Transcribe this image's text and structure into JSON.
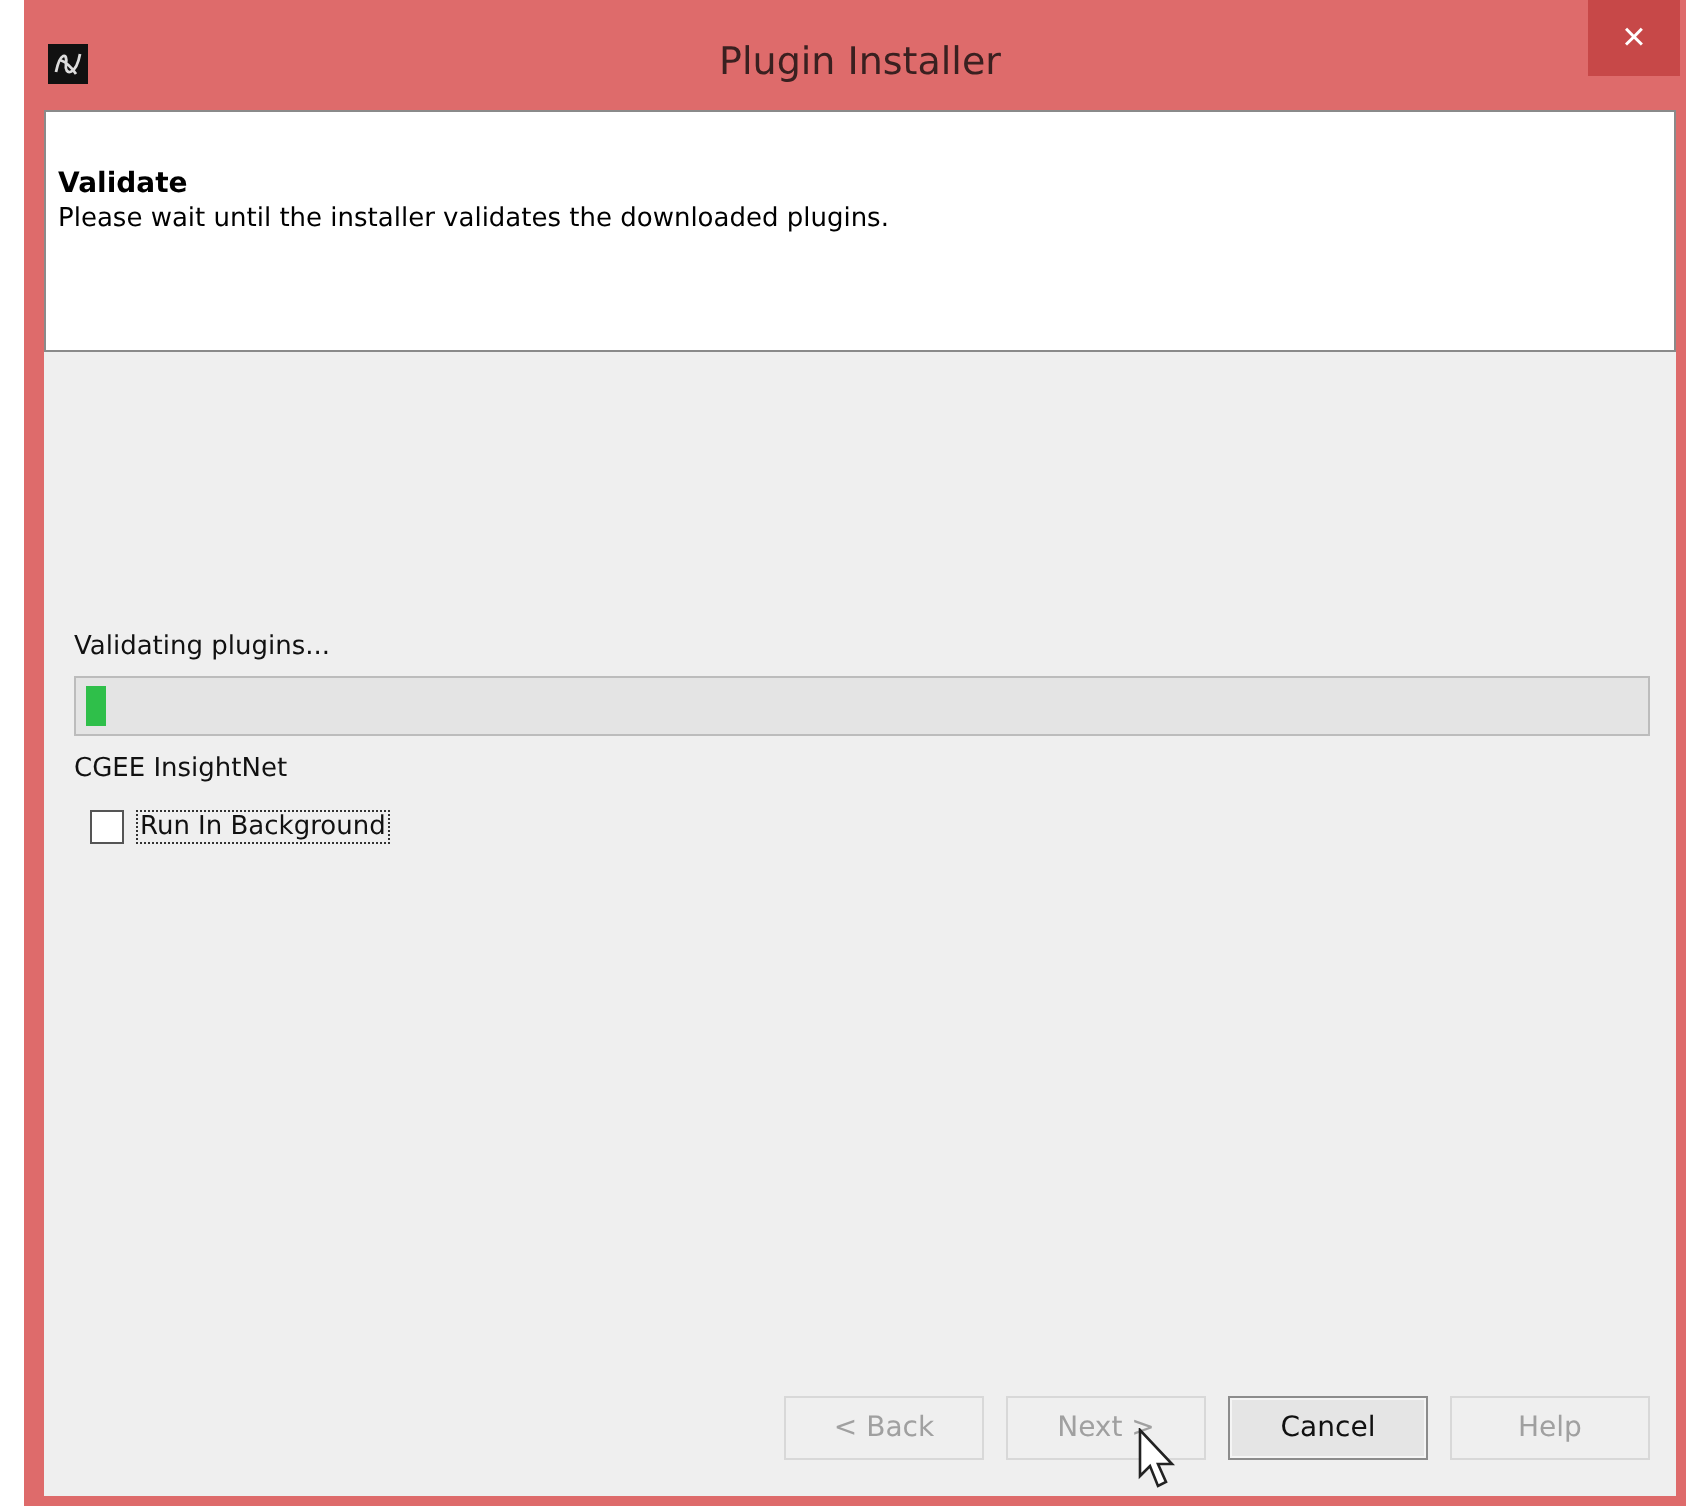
{
  "window": {
    "title": "Plugin Installer",
    "close": "×"
  },
  "header": {
    "title": "Validate",
    "description": "Please wait until the installer validates the downloaded plugins."
  },
  "progress": {
    "label": "Validating plugins...",
    "level": 0.013,
    "item": "CGEE InsightNet"
  },
  "run_in_background": {
    "label": "Run In Background",
    "checked": false
  },
  "buttons": [
    {
      "label": "< Back",
      "disabled": true,
      "kind": "plain"
    },
    {
      "label": "Next >",
      "disabled": true,
      "kind": "plain"
    },
    {
      "label": "Cancel",
      "disabled": false,
      "kind": "default"
    },
    {
      "label": "Help",
      "disabled": true,
      "kind": "plain"
    }
  ]
}
